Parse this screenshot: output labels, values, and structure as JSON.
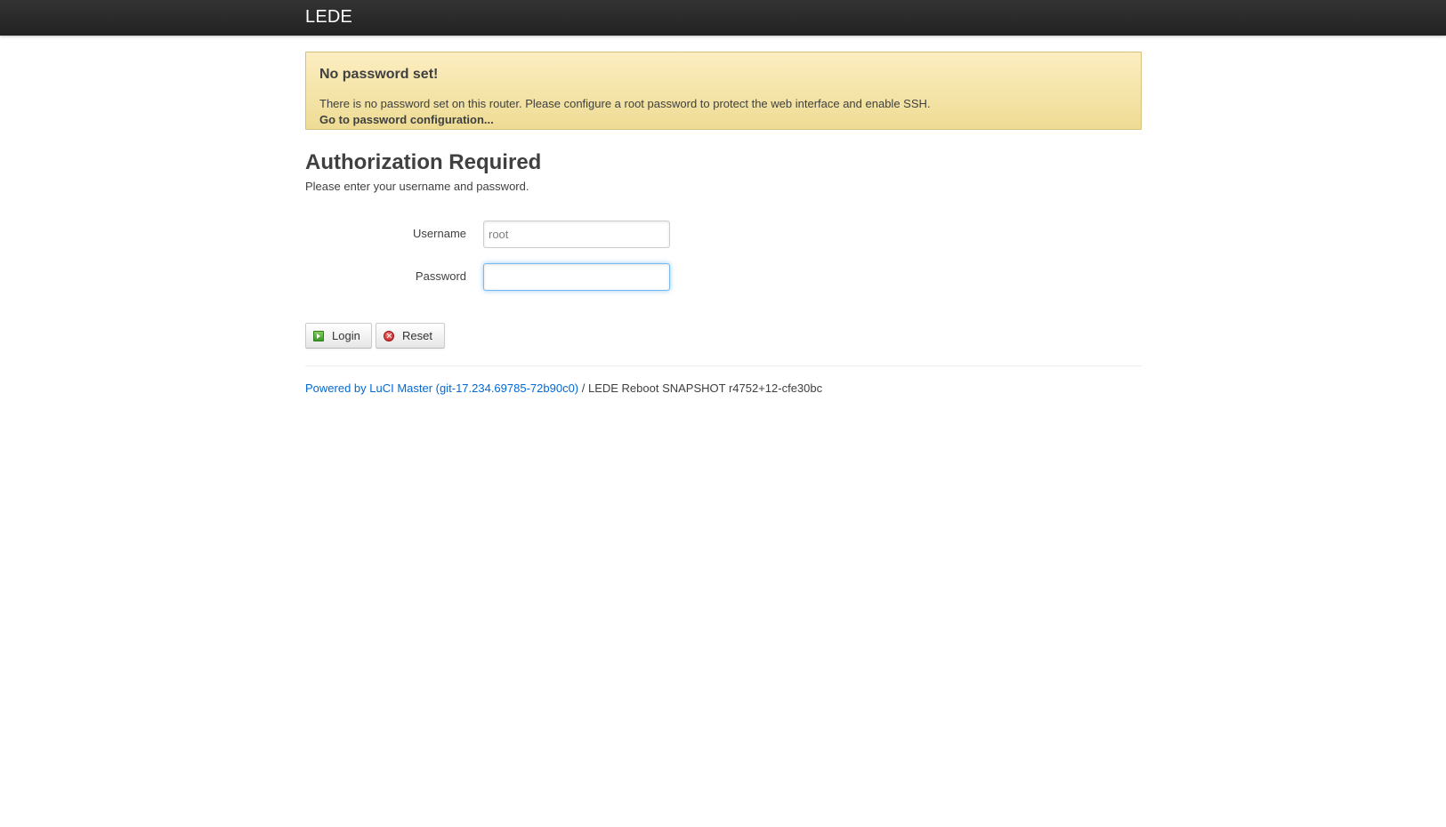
{
  "header": {
    "brand": "LEDE"
  },
  "alert": {
    "title": "No password set!",
    "text": "There is no password set on this router. Please configure a root password to protect the web interface and enable SSH.",
    "link": "Go to password configuration..."
  },
  "main": {
    "title": "Authorization Required",
    "description": "Please enter your username and password."
  },
  "form": {
    "username_label": "Username",
    "username_value": "root",
    "password_label": "Password",
    "password_value": ""
  },
  "actions": {
    "login_label": "Login",
    "reset_label": "Reset",
    "login_icon": "apply-icon",
    "reset_icon": "reset-icon"
  },
  "footer": {
    "powered_link": "Powered by LuCI Master (git-17.234.69785-72b90c0)",
    "version_text": " / LEDE Reboot SNAPSHOT r4752+12-cfe30bc"
  },
  "colors": {
    "topbar": "#222222",
    "alert_bg": "#fceec1",
    "link": "#0069d6",
    "focus": "#52a8ec"
  }
}
